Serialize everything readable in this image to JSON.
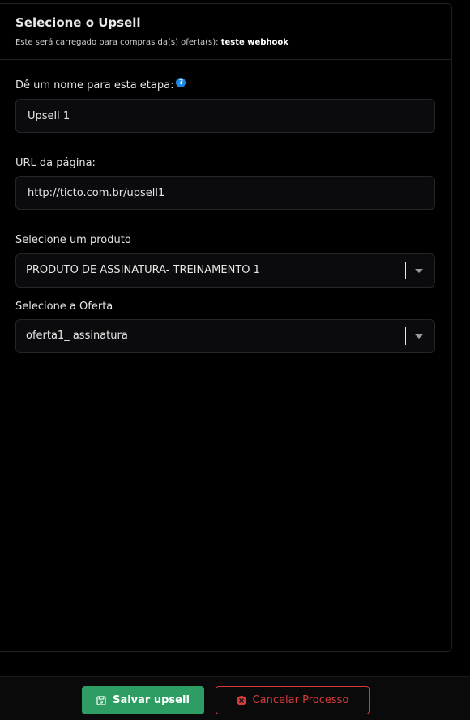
{
  "modal": {
    "title": "Selecione o Upsell",
    "subtitle_prefix": "Este será carregado para compras da(s) oferta(s):",
    "subtitle_offer": "teste webhook"
  },
  "form": {
    "step_name": {
      "label": "Dê um nome para esta etapa:",
      "help_icon": "?",
      "value": "Upsell 1"
    },
    "page_url": {
      "label": "URL da página:",
      "value": "http://ticto.com.br/upsell1"
    },
    "product": {
      "label": "Selecione um produto",
      "selected": "PRODUTO DE ASSINATURA- TREINAMENTO 1"
    },
    "offer": {
      "label": "Selecione a Oferta",
      "selected": "oferta1_ assinatura"
    }
  },
  "footer": {
    "save_label": "Salvar upsell",
    "cancel_label": "Cancelar Processo"
  },
  "colors": {
    "save_bg": "#2e9d63",
    "cancel": "#d43a3a",
    "help_icon": "#1e88e5"
  },
  "icons": {
    "save": "save-icon",
    "cancel": "x-circle-icon",
    "help": "question-circle-icon",
    "dropdown": "caret-down-icon"
  }
}
